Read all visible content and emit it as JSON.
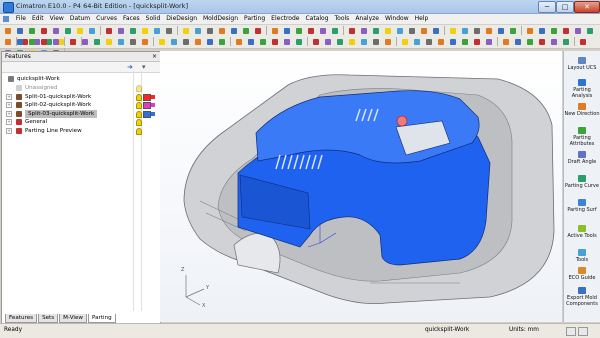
{
  "window": {
    "title": "Cimatron E10.0 - P4 64-Bit Edition - [quicksplit-Work]",
    "min": "─",
    "max": "□",
    "close": "✕"
  },
  "menu": [
    "File",
    "Edit",
    "View",
    "Datum",
    "Curves",
    "Faces",
    "Solid",
    "DieDesign",
    "MoldDesign",
    "Parting",
    "Electrode",
    "Catalog",
    "Tools",
    "Analyze",
    "Window",
    "Help"
  ],
  "features_panel": {
    "title": "Features",
    "close": "×",
    "root": "quicksplit-Work",
    "items": [
      {
        "label": "Unassigned",
        "color": "#cfcfcf",
        "muted": true
      },
      {
        "label": "Split-01-quicksplit-Work",
        "color": "#7f4b2a",
        "swatch": "#ff2424",
        "sel": false
      },
      {
        "label": "Split-02-quicksplit-Work",
        "color": "#7f4b2a",
        "swatch": "#e23bc6",
        "sel": false
      },
      {
        "label": "Split-03-quicksplit-Work",
        "color": "#7f4b2a",
        "swatch": "#2f6fe0",
        "sel": true
      },
      {
        "label": "General",
        "color": "#c23131"
      },
      {
        "label": "Parting Line Preview",
        "color": "#c23131"
      }
    ],
    "tabs": [
      "Features",
      "Sets",
      "M-View",
      "Parting"
    ],
    "active_tab": "Parting"
  },
  "viewport": {
    "axes": {
      "x": "X",
      "y": "Y",
      "z": "Z"
    },
    "colors": {
      "part": "#1f62f0",
      "part_dark": "#1747b7",
      "tool": "#c7c9cc",
      "tool_dark": "#9ea1a6"
    }
  },
  "right_panel": [
    {
      "label": "Layout UCS",
      "icon": "#5e86c3"
    },
    {
      "label": "Parting Analysis",
      "icon": "#2e74d1"
    },
    {
      "label": "New Direction",
      "icon": "#e07b22"
    },
    {
      "label": "Parting Attributes",
      "icon": "#3aa33a"
    },
    {
      "label": "Draft Angle",
      "icon": "#5f72c8"
    },
    {
      "label": "Parting Curve",
      "icon": "#2c9e6c"
    },
    {
      "label": "Parting Surf",
      "icon": "#3f82d5"
    },
    {
      "label": "Active Tools",
      "icon": "#8ebd2a"
    },
    {
      "label": "Tools",
      "icon": "#47a1d6"
    },
    {
      "label": "ECO Guide",
      "icon": "#d98a28"
    },
    {
      "label": "Export Mold Components",
      "icon": "#3a6fc2"
    }
  ],
  "status": {
    "left": "Ready",
    "file": "quicksplit-Work",
    "units": "Units: mm"
  }
}
